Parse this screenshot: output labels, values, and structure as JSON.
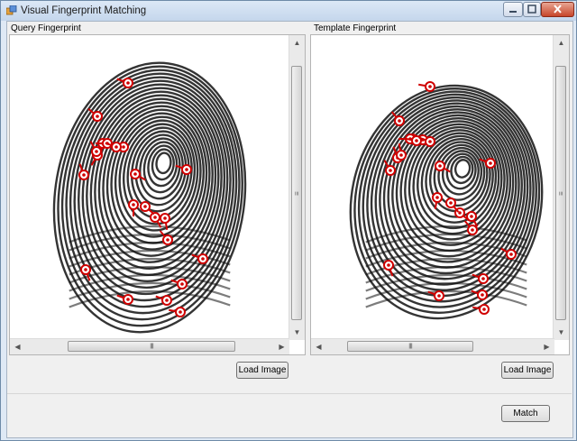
{
  "window": {
    "title": "Visual Fingerprint Matching"
  },
  "query": {
    "label": "Query Fingerprint",
    "load_button": "Load Image",
    "grip": "III",
    "minutiae_count": 22
  },
  "template": {
    "label": "Template Fingerprint",
    "load_button": "Load Image",
    "grip": "III",
    "minutiae_count": 22
  },
  "match_button": "Match",
  "icons": {
    "app": "app-icon",
    "minimize": "minimize-icon",
    "maximize": "maximize-icon",
    "close": "close-icon",
    "minutia": "minutia-marker-icon"
  },
  "colors": {
    "minutia": "#d00000",
    "ridge": "#111111"
  }
}
